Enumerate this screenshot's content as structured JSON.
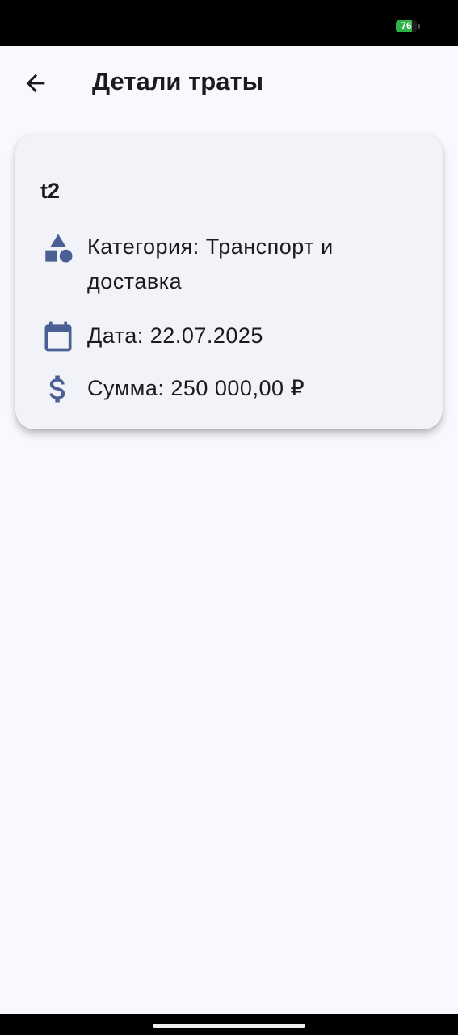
{
  "status_bar": {
    "battery_level": "76",
    "battery_fraction": 0.76,
    "battery_color": "#2fb24a"
  },
  "app_bar": {
    "back_icon": "arrow-back-icon",
    "title": "Детали траты"
  },
  "expense": {
    "name": "t2",
    "category_icon": "category-shapes-icon",
    "category_text": "Категория: Транспорт и доставка",
    "date_icon": "calendar-icon",
    "date_text": "Дата: 22.07.2025",
    "amount_icon": "dollar-icon",
    "amount_text": "Сумма: 250 000,00 ₽"
  },
  "colors": {
    "accent": "#4a5f94",
    "card_background": "#f2f3f8",
    "page_background": "#f8f8fe",
    "text": "#1b1b1f"
  }
}
